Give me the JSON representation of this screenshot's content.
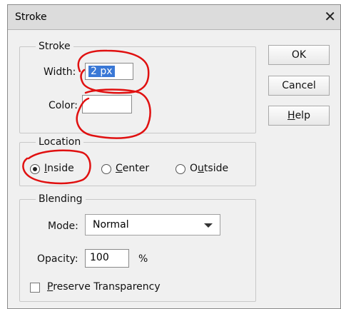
{
  "window": {
    "title": "Stroke",
    "close_glyph": "✕"
  },
  "stroke": {
    "legend": "Stroke",
    "width_label": "Width:",
    "width_value": "2 px",
    "color_label": "Color:"
  },
  "location": {
    "legend": "Location",
    "options": [
      {
        "prefix": "",
        "mnemonic": "I",
        "suffix": "nside",
        "selected": true
      },
      {
        "prefix": "",
        "mnemonic": "C",
        "suffix": "enter",
        "selected": false
      },
      {
        "prefix": "O",
        "mnemonic": "u",
        "suffix": "tside",
        "selected": false
      }
    ]
  },
  "blending": {
    "legend": "Blending",
    "mode_label": "Mode:",
    "mode_value": "Normal",
    "opacity_label": "Opacity:",
    "opacity_value": "100",
    "opacity_unit": "%",
    "preserve_mnemonic": "P",
    "preserve_rest": "reserve Transparency"
  },
  "buttons": {
    "ok": "OK",
    "cancel": "Cancel",
    "help_mnemonic": "H",
    "help_rest": "elp"
  },
  "colors": {
    "annotation": "#e01010",
    "selection": "#3a78d6"
  }
}
